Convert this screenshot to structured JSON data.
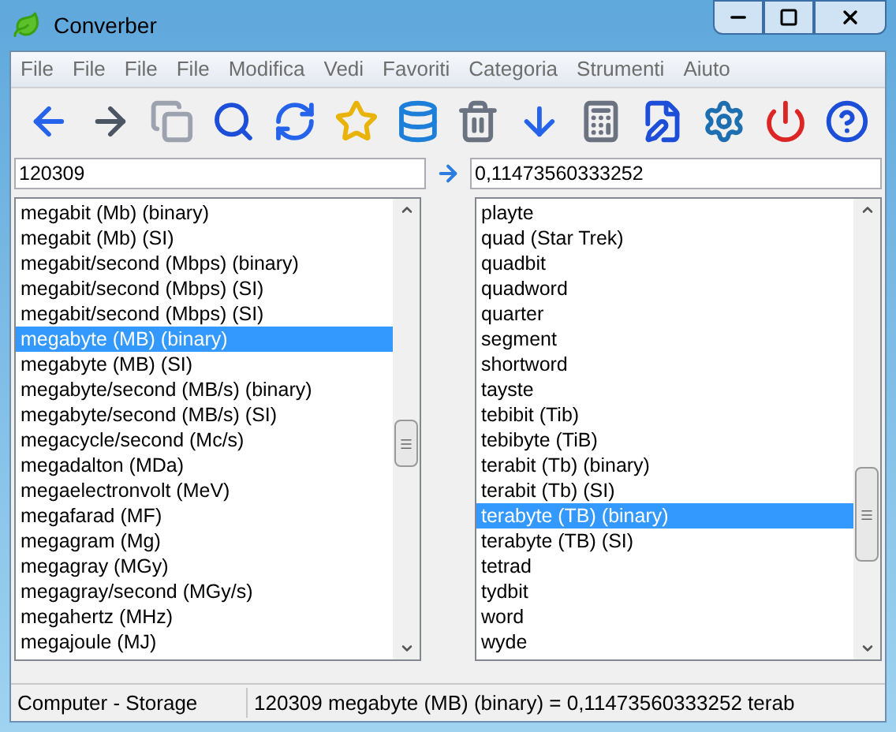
{
  "window": {
    "title": "Converber"
  },
  "menu": [
    "File",
    "File",
    "File",
    "File",
    "Modifica",
    "Vedi",
    "Favoriti",
    "Categoria",
    "Strumenti",
    "Aiuto"
  ],
  "input": {
    "value": "120309"
  },
  "output": {
    "value": "0,11473560333252"
  },
  "from_list": [
    {
      "label": "megabit (Mb) (binary)",
      "selected": false
    },
    {
      "label": "megabit (Mb) (SI)",
      "selected": false
    },
    {
      "label": "megabit/second (Mbps) (binary)",
      "selected": false
    },
    {
      "label": "megabit/second (Mbps) (SI)",
      "selected": false
    },
    {
      "label": "megabit/second (Mbps) (SI)",
      "selected": false
    },
    {
      "label": "megabyte (MB) (binary)",
      "selected": true
    },
    {
      "label": "megabyte (MB) (SI)",
      "selected": false
    },
    {
      "label": "megabyte/second (MB/s) (binary)",
      "selected": false
    },
    {
      "label": "megabyte/second (MB/s) (SI)",
      "selected": false
    },
    {
      "label": "megacycle/second (Mc/s)",
      "selected": false
    },
    {
      "label": "megadalton (MDa)",
      "selected": false
    },
    {
      "label": "megaelectronvolt (MeV)",
      "selected": false
    },
    {
      "label": "megafarad (MF)",
      "selected": false
    },
    {
      "label": "megagram (Mg)",
      "selected": false
    },
    {
      "label": "megagray (MGy)",
      "selected": false
    },
    {
      "label": "megagray/second (MGy/s)",
      "selected": false
    },
    {
      "label": "megahertz (MHz)",
      "selected": false
    },
    {
      "label": "megajoule (MJ)",
      "selected": false
    }
  ],
  "to_list": [
    {
      "label": "playte",
      "selected": false
    },
    {
      "label": "quad (Star Trek)",
      "selected": false
    },
    {
      "label": "quadbit",
      "selected": false
    },
    {
      "label": "quadword",
      "selected": false
    },
    {
      "label": "quarter",
      "selected": false
    },
    {
      "label": "segment",
      "selected": false
    },
    {
      "label": "shortword",
      "selected": false
    },
    {
      "label": "tayste",
      "selected": false
    },
    {
      "label": "tebibit (Tib)",
      "selected": false
    },
    {
      "label": "tebibyte (TiB)",
      "selected": false
    },
    {
      "label": "terabit (Tb) (binary)",
      "selected": false
    },
    {
      "label": "terabit (Tb) (SI)",
      "selected": false
    },
    {
      "label": "terabyte (TB) (binary)",
      "selected": true
    },
    {
      "label": "terabyte (TB) (SI)",
      "selected": false
    },
    {
      "label": "tetrad",
      "selected": false
    },
    {
      "label": "tydbit",
      "selected": false
    },
    {
      "label": "word",
      "selected": false
    },
    {
      "label": "wyde",
      "selected": false
    }
  ],
  "status_bar": {
    "category": "Computer - Storage",
    "result": "120309 megabyte (MB) (binary) = 0,11473560333252 terab"
  }
}
